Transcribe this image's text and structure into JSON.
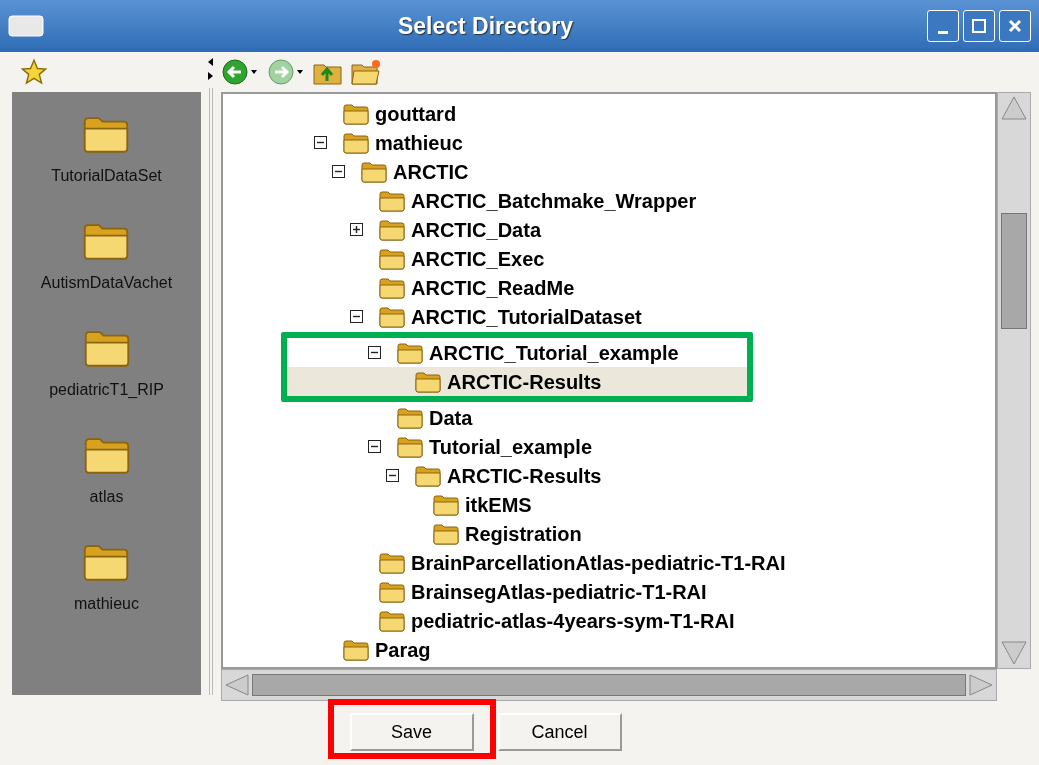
{
  "window": {
    "title": "Select Directory"
  },
  "shortcuts": [
    {
      "label": "TutorialDataSet"
    },
    {
      "label": "AutismDataVachet"
    },
    {
      "label": "pediatricT1_RIP"
    },
    {
      "label": "atlas"
    },
    {
      "label": "mathieuc"
    }
  ],
  "tree": [
    {
      "label": "gouttard"
    },
    {
      "label": "mathieuc",
      "expanded": true,
      "children": [
        {
          "label": "ARCTIC",
          "expanded": true,
          "children": [
            {
              "label": "ARCTIC_Batchmake_Wrapper"
            },
            {
              "label": "ARCTIC_Data",
              "expanded": false
            },
            {
              "label": "ARCTIC_Exec"
            },
            {
              "label": "ARCTIC_ReadMe"
            },
            {
              "label": "ARCTIC_TutorialDataset",
              "expanded": true,
              "children": [
                {
                  "label": "ARCTIC_Tutorial_example",
                  "expanded": true,
                  "color": "#00b050",
                  "children": [
                    {
                      "label": "ARCTIC-Results",
                      "selected": true
                    }
                  ]
                },
                {
                  "label": "Data"
                },
                {
                  "label": "Tutorial_example",
                  "expanded": true,
                  "children": [
                    {
                      "label": "ARCTIC-Results",
                      "expanded": true,
                      "children": [
                        {
                          "label": "itkEMS"
                        },
                        {
                          "label": "Registration"
                        }
                      ]
                    }
                  ]
                }
              ]
            },
            {
              "label": "BrainParcellationAtlas-pediatric-T1-RAI"
            },
            {
              "label": "BrainsegAtlas-pediatric-T1-RAI"
            },
            {
              "label": "pediatric-atlas-4years-sym-T1-RAI"
            }
          ]
        }
      ]
    },
    {
      "label": "Parag"
    }
  ],
  "buttons": [
    {
      "label": "Save",
      "color": "#ff0000"
    },
    {
      "label": "Cancel"
    }
  ]
}
